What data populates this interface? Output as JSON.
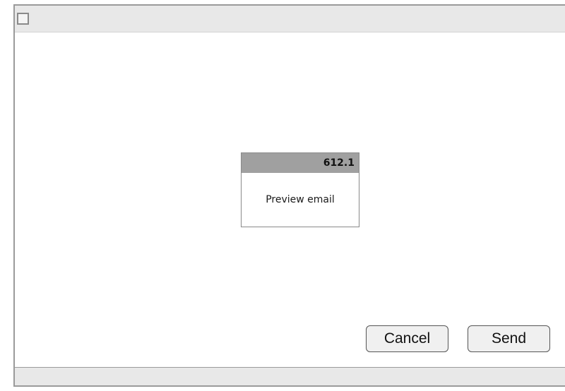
{
  "step": {
    "number": "612.1",
    "label": "Preview email"
  },
  "buttons": {
    "cancel_label": "Cancel",
    "send_label": "Send"
  },
  "icons": {
    "window": "window-icon"
  }
}
